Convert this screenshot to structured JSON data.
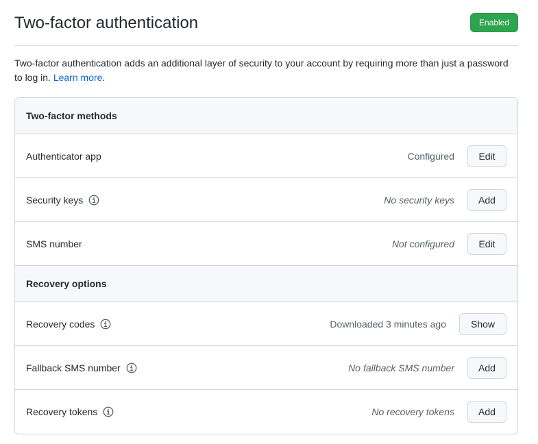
{
  "header": {
    "title": "Two-factor authentication",
    "badge": "Enabled"
  },
  "description": {
    "text": "Two-factor authentication adds an additional layer of security to your account by requiring more than just a password to log in. ",
    "link": "Learn more",
    "end": "."
  },
  "methods": {
    "heading": "Two-factor methods",
    "rows": [
      {
        "label": "Authenticator app",
        "status": "Configured",
        "button": "Edit"
      },
      {
        "label": "Security keys",
        "status": "No security keys",
        "button": "Add"
      },
      {
        "label": "SMS number",
        "status": "Not configured",
        "button": "Edit"
      }
    ]
  },
  "recovery": {
    "heading": "Recovery options",
    "rows": [
      {
        "label": "Recovery codes",
        "status": "Downloaded 3 minutes ago",
        "button": "Show"
      },
      {
        "label": "Fallback SMS number",
        "status": "No fallback SMS number",
        "button": "Add"
      },
      {
        "label": "Recovery tokens",
        "status": "No recovery tokens",
        "button": "Add"
      }
    ]
  },
  "colors": {
    "badge": "#2da44e",
    "link": "#0969da",
    "border": "#d0d7de",
    "header_bg": "#f6f8fa"
  },
  "icons": {
    "info": "info-icon"
  }
}
